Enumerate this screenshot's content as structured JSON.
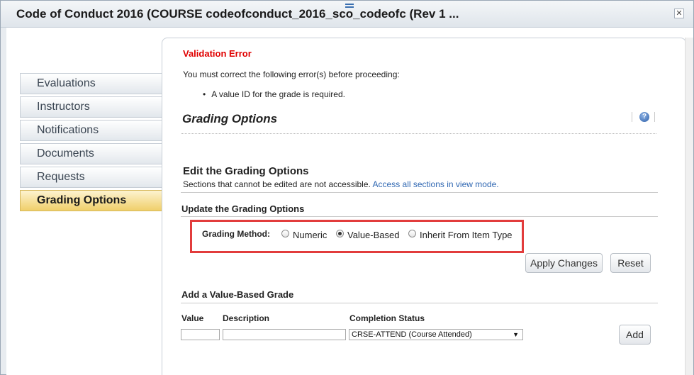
{
  "window": {
    "title": "Code of Conduct 2016 (COURSE codeofconduct_2016_sco_codeofc (Rev 1 ...",
    "close_glyph": "✕"
  },
  "sidebar": {
    "items": [
      {
        "label": "Evaluations",
        "active": false
      },
      {
        "label": "Instructors",
        "active": false
      },
      {
        "label": "Notifications",
        "active": false
      },
      {
        "label": "Documents",
        "active": false
      },
      {
        "label": "Requests",
        "active": false
      },
      {
        "label": "Grading Options",
        "active": true
      }
    ]
  },
  "validation": {
    "title": "Validation Error",
    "message": "You must correct the following error(s) before proceeding:",
    "errors": [
      "A value ID for the grade is required."
    ]
  },
  "page": {
    "title": "Grading Options",
    "help_glyph": "?"
  },
  "edit": {
    "title": "Edit the Grading Options",
    "description": "Sections that cannot be edited are not accessible.",
    "link": "Access all sections in view mode."
  },
  "update": {
    "title": "Update the Grading Options",
    "grading_method_label": "Grading Method:",
    "options": [
      {
        "label": "Numeric",
        "checked": false
      },
      {
        "label": "Value-Based",
        "checked": true
      },
      {
        "label": "Inherit From Item Type",
        "checked": false
      }
    ],
    "apply_label": "Apply Changes",
    "reset_label": "Reset"
  },
  "add_grade": {
    "title": "Add a Value-Based Grade",
    "columns": [
      "Value",
      "Description",
      "Completion Status"
    ],
    "value": "",
    "description": "",
    "completion_status": "CRSE-ATTEND (Course Attended)",
    "add_label": "Add"
  },
  "colors": {
    "error": "#e00000",
    "highlight_box": "#e23c3c",
    "link": "#2f67b2",
    "active_tab": "#f0cf6a"
  }
}
